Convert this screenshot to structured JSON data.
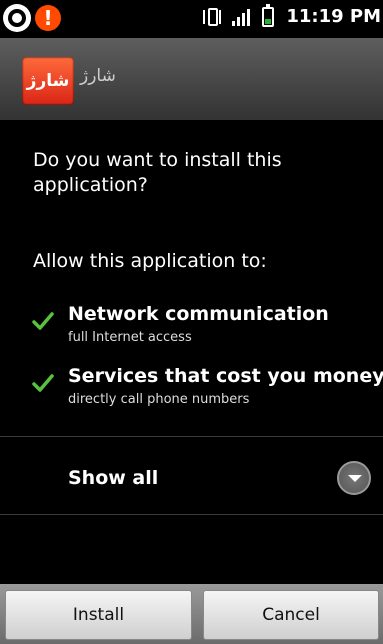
{
  "status_bar": {
    "time": "11:19 PM",
    "icons": [
      "viber-icon",
      "alert-icon",
      "vibrate-icon",
      "signal-icon",
      "battery-icon"
    ],
    "alert_glyph": "!"
  },
  "app": {
    "icon_text": "شارژ",
    "name": "شارژ"
  },
  "prompt": {
    "question": "Do you want to install this application?",
    "allow_heading": "Allow this application to:"
  },
  "permissions": [
    {
      "title": "Network communication",
      "subtitle": "full Internet access"
    },
    {
      "title": "Services that cost you money",
      "subtitle": "directly call phone numbers"
    }
  ],
  "show_all": {
    "label": "Show all"
  },
  "buttons": {
    "install": "Install",
    "cancel": "Cancel"
  },
  "colors": {
    "check": "#59c23c",
    "app_icon": "#e5351f",
    "alert": "#ff4a00"
  }
}
